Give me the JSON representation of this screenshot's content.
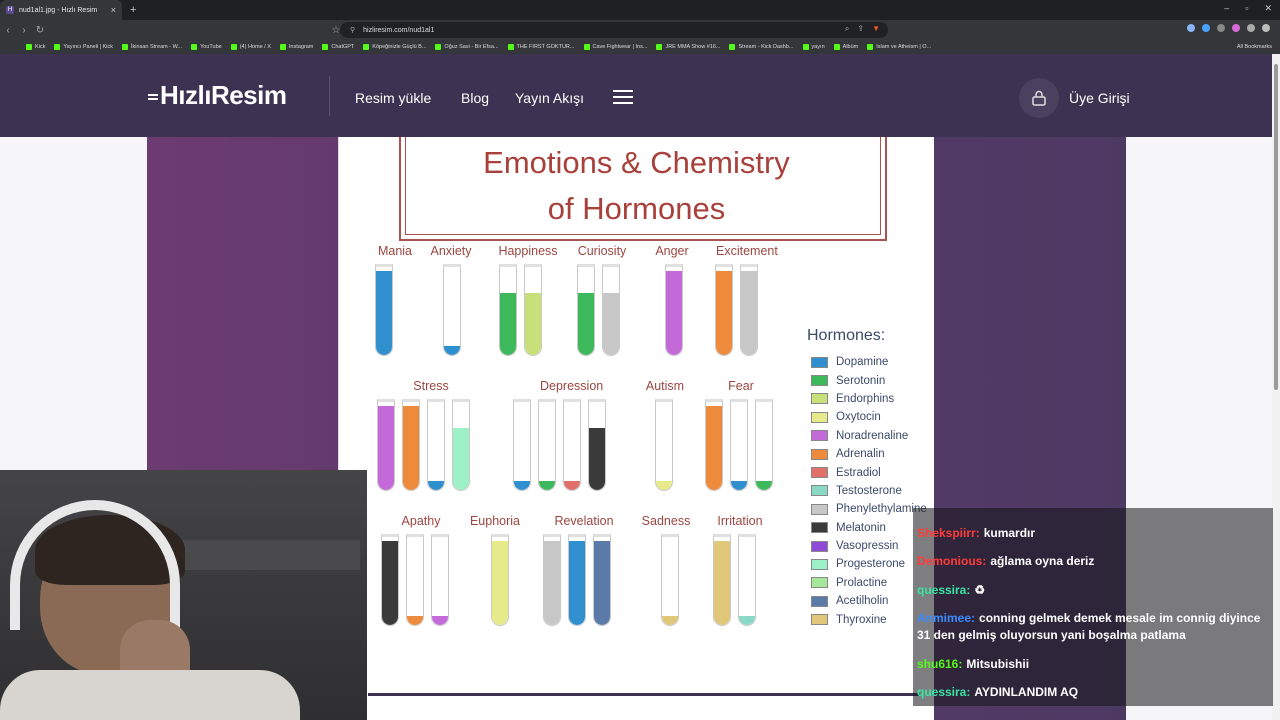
{
  "browser": {
    "tab_title": "nud1al1.jpg - Hızlı Resim",
    "tab_icon_letter": "H",
    "new_tab": "+",
    "url": "hizliresim.com/nud1al1",
    "bookmarks": [
      "Kick",
      "Yayıncı Paneli | Kick",
      "İkinsan Stream - W...",
      "YouTube",
      "(4) Home / X",
      "Instagram",
      "ChatGPT",
      "Köpeğinizle Güçlü B...",
      "Oğuz Sasi - Bir Efsa...",
      "THE FIRST GOKTUR...",
      "Cave Fightwear | Ins...",
      "JRE MMA Show #16...",
      "Stream - Kick Dashb...",
      "yayın",
      "Albüm",
      "Islam ve Atheism | O..."
    ],
    "all_bookmarks": "All Bookmarks"
  },
  "site": {
    "logo": "HızlıResim",
    "nav": [
      "Resim yükle",
      "Blog",
      "Yayın Akışı"
    ],
    "login": "Üye Girişi"
  },
  "poster": {
    "title_line1": "Emotions & Chemistry",
    "title_line2": "of Hormones",
    "row1": [
      "Mania",
      "Anxiety",
      "Happiness",
      "Curiosity",
      "Anger",
      "Excitement"
    ],
    "row2": [
      "Stress",
      "Depression",
      "Autism",
      "Fear"
    ],
    "row3": [
      "Apathy",
      "Euphoria",
      "Revelation",
      "Sadness",
      "Irritation"
    ],
    "legend_title": "Hormones:",
    "legend": [
      {
        "name": "Dopamine",
        "color": "#2f8fcf"
      },
      {
        "name": "Serotonin",
        "color": "#3db85a"
      },
      {
        "name": "Endorphins",
        "color": "#c7e07a"
      },
      {
        "name": "Oxytocin",
        "color": "#e6ea8a"
      },
      {
        "name": "Noradrenaline",
        "color": "#c46ad8"
      },
      {
        "name": "Adrenalin",
        "color": "#ee8a3c"
      },
      {
        "name": "Estradiol",
        "color": "#e07068"
      },
      {
        "name": "Testosterone",
        "color": "#8ad8c6"
      },
      {
        "name": "Phenylethylamine",
        "color": "#c7c7c7"
      },
      {
        "name": "Melatonin",
        "color": "#3a3a3a"
      },
      {
        "name": "Vasopressin",
        "color": "#8f4ad8"
      },
      {
        "name": "Progesterone",
        "color": "#9ef0c6"
      },
      {
        "name": "Prolactine",
        "color": "#a6e89a"
      },
      {
        "name": "Acetilholin",
        "color": "#5a7aa8"
      },
      {
        "name": "Thyroxine",
        "color": "#e0c77a"
      }
    ]
  },
  "chat": {
    "messages": [
      {
        "user": "Shekspiirr:",
        "text": "kumardır",
        "color": "#ff3b3b"
      },
      {
        "user": "Demonious:",
        "text": "ağlama oyna deriz",
        "color": "#ff3b3b"
      },
      {
        "user": "quessira:",
        "text": "♻",
        "color": "#39e5a5"
      },
      {
        "user": "Anmimee:",
        "text": "conning gelmek demek mesale im connig diyince 31 den gelmiş oluyorsun yani boşalma patlama",
        "color": "#3b8bff"
      },
      {
        "user": "shu616:",
        "text": "Mitsubishii",
        "color": "#53fc18"
      },
      {
        "user": "quessira:",
        "text": "AYDINLANDIM AQ",
        "color": "#39e5a5"
      }
    ]
  }
}
